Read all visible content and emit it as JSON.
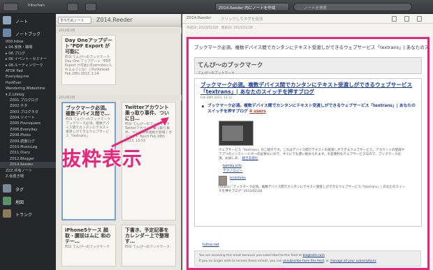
{
  "titlebar": {
    "account": "hitochan",
    "create_button": "Z014.Reeder 内にノートを作成",
    "search_placeholder": "ノートを検索"
  },
  "sidebar": {
    "notes_label": "ノート",
    "notebooks_label": "ノートブック",
    "items": [
      {
        "label": "000.Inbox",
        "sub": false
      },
      {
        "label": "▸ 04.家族・職場",
        "sub": false
      },
      {
        "label": "▸ 08.ブログ",
        "sub": false
      },
      {
        "label": "▸ 06 イベント・セミナー",
        "sub": false
      },
      {
        "label": "▸ 08.ルーティンワーク",
        "sub": false
      },
      {
        "label": "ATOK Pad",
        "sub": false
      },
      {
        "label": "Everyday.me",
        "sub": false
      },
      {
        "label": "PostEver",
        "sub": false
      },
      {
        "label": "Wandering Wideshine",
        "sub": false
      },
      {
        "label": "▾ Z.Lifelog",
        "sub": false
      },
      {
        "label": "Z001.ブログログ",
        "sub": true
      },
      {
        "label": "Z002.ネタ",
        "sub": true
      },
      {
        "label": "Z003.ブログネタ",
        "sub": true
      },
      {
        "label": "Z004.ツイート",
        "sub": true
      },
      {
        "label": "Z005.Foursquare",
        "sub": true
      },
      {
        "label": "Z006.Everyday",
        "sub": true
      },
      {
        "label": "Z008.Photo",
        "sub": true
      },
      {
        "label": "Z009.読書ログ",
        "sub": true
      },
      {
        "label": "Z010.MusicLog",
        "sub": true
      },
      {
        "label": "Z011.Diary",
        "sub": true
      },
      {
        "label": "Z012.Blogger",
        "sub": true
      },
      {
        "label": "Z014.Reeder",
        "sub": true,
        "active": true
      },
      {
        "label": "ZZZ.共有ノート",
        "sub": false
      },
      {
        "label": "Z.仮置き場",
        "sub": false
      }
    ],
    "tags_label": "タグ",
    "atlas_label": "地図",
    "trunk_label": "トランク"
  },
  "list": {
    "all_notes": "すべてのノート",
    "title": "Z014.Reeder",
    "sections": [
      "2013年3月",
      "2013年2月"
    ],
    "cards": [
      {
        "title": "Day Oneアップデート\"PDF Export が可能に",
        "body": "昨日 てんぴ〜のブックマーク Day One アップデート「PDF Export が可能にEvernoteに入れるようにな！ | Punkstead Feb 28th 2013, 1:14"
      },
      {
        "title": "ブックマーク必須。複数デバイス間で…",
        "body": "昨日 てんぴ〜のブックマーク ブックマーク必須。複数デバイス間でカンタンにテキスト受渡しができるウェブサービス「textrans」"
      },
      {
        "title": "Twitterアカウント乗っ取り事件、ついに日…",
        "body": "昨日 てんぴ〜のブックマーク Twitterアカウント乗っ取り事件、ついに日本語版が登場 | ガジェット Touch Feb 28th 2013, 13:53"
      },
      {
        "title": "iPhone5ケース 顔取・腰前はムに 和のテー…",
        "body": "昨日 てんぴ〜のブックマーク"
      },
      {
        "title": "下書き、予定記事をカレンダー上で整理す…",
        "body": "昨日 てんぴ〜のブックマーク"
      }
    ]
  },
  "callout": {
    "text": "抜粋表示"
  },
  "pane": {
    "notebook": "Z014.Reeder",
    "tags_placeholder": "クリックしてタグを追加",
    "created": "作成日: 2013/02/28",
    "updated": "更新日: 2013/02/28",
    "note_title": "ブックマーク必須。複数デバイス間でカンタンにテキスト受渡しができるウェブサービス「textrans」| あなたのスイッチを押すブログ",
    "blog_title": "てんぴ〜のブックマーク",
    "blog_subtitle": "てんぴ〜のブックマーク",
    "post_title": "ブックマーク必須。複数デバイス間でカンタンにテキスト受渡しができるウェブサービス「textrans」| あなたのスイッチを押すブログ",
    "post_date": "Feb 28th 2013, 13:12",
    "bullet_text": "ブックマーク必須。複数デバイス間でカンタンにテキスト受渡しができるウェブサービス「textrans」| あなたのスイッチを押すブログ",
    "bullet_users": "4 users",
    "description": "ウェブサービス「textrans」のご紹介です。これはデバイス間でテキストの受渡しができるウェブサービス。アカウントの登録やアプリのインストールが一切必要ないので、すぐにでも使い始められます。大変便利なウェブサービスなので、ブックマーク必須。お試しあ…",
    "description_more": "続きを読む",
    "sublinks": [
      "bamka.info",
      "テクノロジー"
    ],
    "comment_user": "tenbitaiko",
    "comment_text": "[Share] \"ブックマーク必須。複数デバイス間でカンタンにテキスト受渡しができるウェブサービス「textrans」| あなたのスイッチを押すブログ\" 2013/02/28",
    "fullrss": "fullrss.net",
    "footer_line1_pre": "You are receiving this email because you subscribed to this feed at",
    "footer_line1_link": "blogtrottr.com",
    "footer_line2_pre": "If you no longer wish to receive these emails, you can",
    "footer_line2_link1": "unsubscribe from this feed",
    "footer_line2_mid": ", or",
    "footer_line2_link2": "manage all your subscriptions"
  },
  "colors": {
    "accent": "#e8257a",
    "link": "#1b3d98"
  }
}
